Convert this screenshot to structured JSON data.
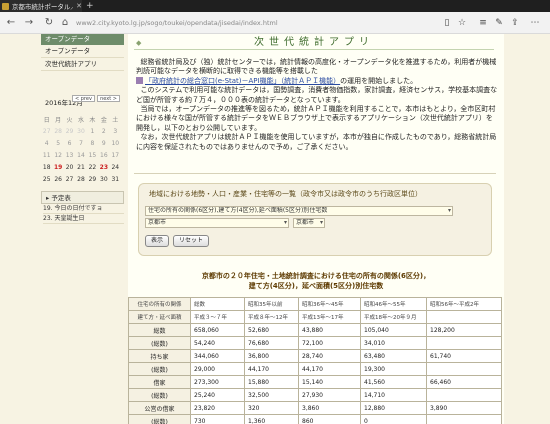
{
  "browser": {
    "tab_title": "京都市統計ポータル／次世",
    "tab_close": "✕",
    "new_tab": "+",
    "url_host": "www2.city.kyoto.lg.jp",
    "url_path": "/sogo/toukei/opendata/jisedai/index.html"
  },
  "sidebar": {
    "section_title": "オープンデータ",
    "items": [
      "オープンデータ",
      "次世代統計アプリ"
    ],
    "calendar": {
      "title": "2016年12月",
      "prev": "< prev",
      "next": "next >",
      "weekdays": [
        "日",
        "月",
        "火",
        "水",
        "木",
        "金",
        "土"
      ],
      "weeks": [
        [
          "27",
          "28",
          "29",
          "30",
          "1",
          "2",
          "3"
        ],
        [
          "4",
          "5",
          "6",
          "7",
          "8",
          "9",
          "10"
        ],
        [
          "11",
          "12",
          "13",
          "14",
          "15",
          "16",
          "17"
        ],
        [
          "18",
          "19",
          "20",
          "21",
          "22",
          "23",
          "24"
        ],
        [
          "25",
          "26",
          "27",
          "28",
          "29",
          "30",
          "31"
        ]
      ]
    },
    "schedule_title": "予定表",
    "schedule_items": [
      "19. 今日の日付ですョ",
      "23. 天皇誕生日"
    ]
  },
  "main": {
    "title": "次世代統計アプリ",
    "intro_p1": "総務省統計局及び（独）統計センターでは，統計情報の高度化・オープンデータ化を推進するため，利用者が機械判読可能なデータを横断的に取得できる機能等を搭載した",
    "intro_link": "「政府統計の総合窓口(e-Stat)－API機能」（統計ＡＰＩ機能）",
    "intro_p1_end": "の運用を開始しました。",
    "intro_p2": "このシステムで利用可能な統計データは，国勢調査，消費者物価指数，家計調査，経済センサス，学校基本調査など国が所管する約７万４，０００表の統計データとなっています。",
    "intro_p3": "当局では，オープンデータの推進等を図るため，統計ＡＰＩ機能を利用することで，本市はもとより，全市区町村における様々な国が所管する統計データをＷＥＢブラウザ上で表示するアプリケーション（次世代統計アプリ）を開発し，以下のとおり公開しています。",
    "intro_p4": "なお，次世代統計アプリは統計ＡＰＩ機能を使用していますが，本市が独自に作成したものであり，総務省統計局に内容を保証されたものではありませんので予め，ご了承ください。"
  },
  "form": {
    "heading": "地域における地勢・人口・産業・住宅等の一覧（政令市又は政令市のうち行政区単位）",
    "select_main": "住宅の所有の関係(6区分),建て方(4区分),延べ面積(5区分)別住宅数",
    "select_city": "京都市",
    "select_ward": "京都市",
    "show_button": "表示",
    "reset_button": "リセット"
  },
  "table": {
    "title_line1": "京都市の２０年住宅・土地統計調査における住宅の所有の関係(6区分)，",
    "title_line2": "建て方(4区分)，延べ面積(5区分)別住宅数",
    "header1": [
      "住宅の所有の関係",
      "総数",
      "昭和35年以前",
      "昭和36年～45年",
      "昭和46年～55年",
      "昭和56年～平成2年"
    ],
    "header2": [
      "建て方・延べ面積",
      "平成３～７年",
      "平成８年～12年",
      "平成13年～17年",
      "平成18年～20年９月",
      ""
    ],
    "rows": [
      [
        "総数",
        "658,060",
        "52,680",
        "43,880",
        "105,040",
        "128,200"
      ],
      [
        "(総数)",
        "54,240",
        "76,680",
        "72,100",
        "34,010",
        ""
      ],
      [
        "持ち家",
        "344,060",
        "36,800",
        "28,740",
        "63,480",
        "61,740"
      ],
      [
        "(総数)",
        "29,000",
        "44,170",
        "44,170",
        "19,300",
        ""
      ],
      [
        "借家",
        "273,300",
        "15,880",
        "15,140",
        "41,560",
        "66,460"
      ],
      [
        "(総数)",
        "25,240",
        "32,500",
        "27,930",
        "14,710",
        ""
      ],
      [
        "公営の借家",
        "23,820",
        "320",
        "3,860",
        "12,880",
        "3,890"
      ],
      [
        "(総数)",
        "730",
        "1,360",
        "860",
        "0",
        ""
      ]
    ]
  }
}
